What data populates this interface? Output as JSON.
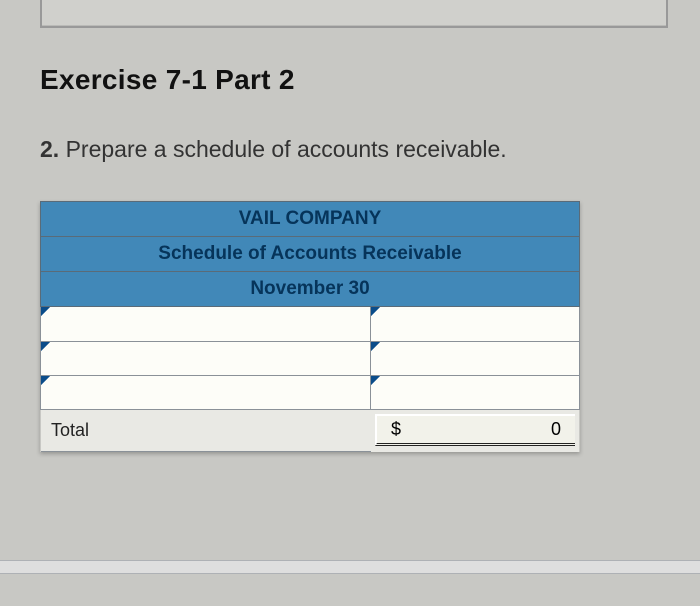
{
  "exercise": {
    "title": "Exercise 7-1 Part 2",
    "step_number": "2.",
    "instruction": "Prepare a schedule of accounts receivable."
  },
  "schedule": {
    "company": "VAIL COMPANY",
    "report_title": "Schedule of Accounts Receivable",
    "date": "November 30",
    "rows": [
      {
        "name": "",
        "amount": ""
      },
      {
        "name": "",
        "amount": ""
      },
      {
        "name": "",
        "amount": ""
      }
    ],
    "total_label": "Total",
    "total_currency": "$",
    "total_value": "0"
  }
}
